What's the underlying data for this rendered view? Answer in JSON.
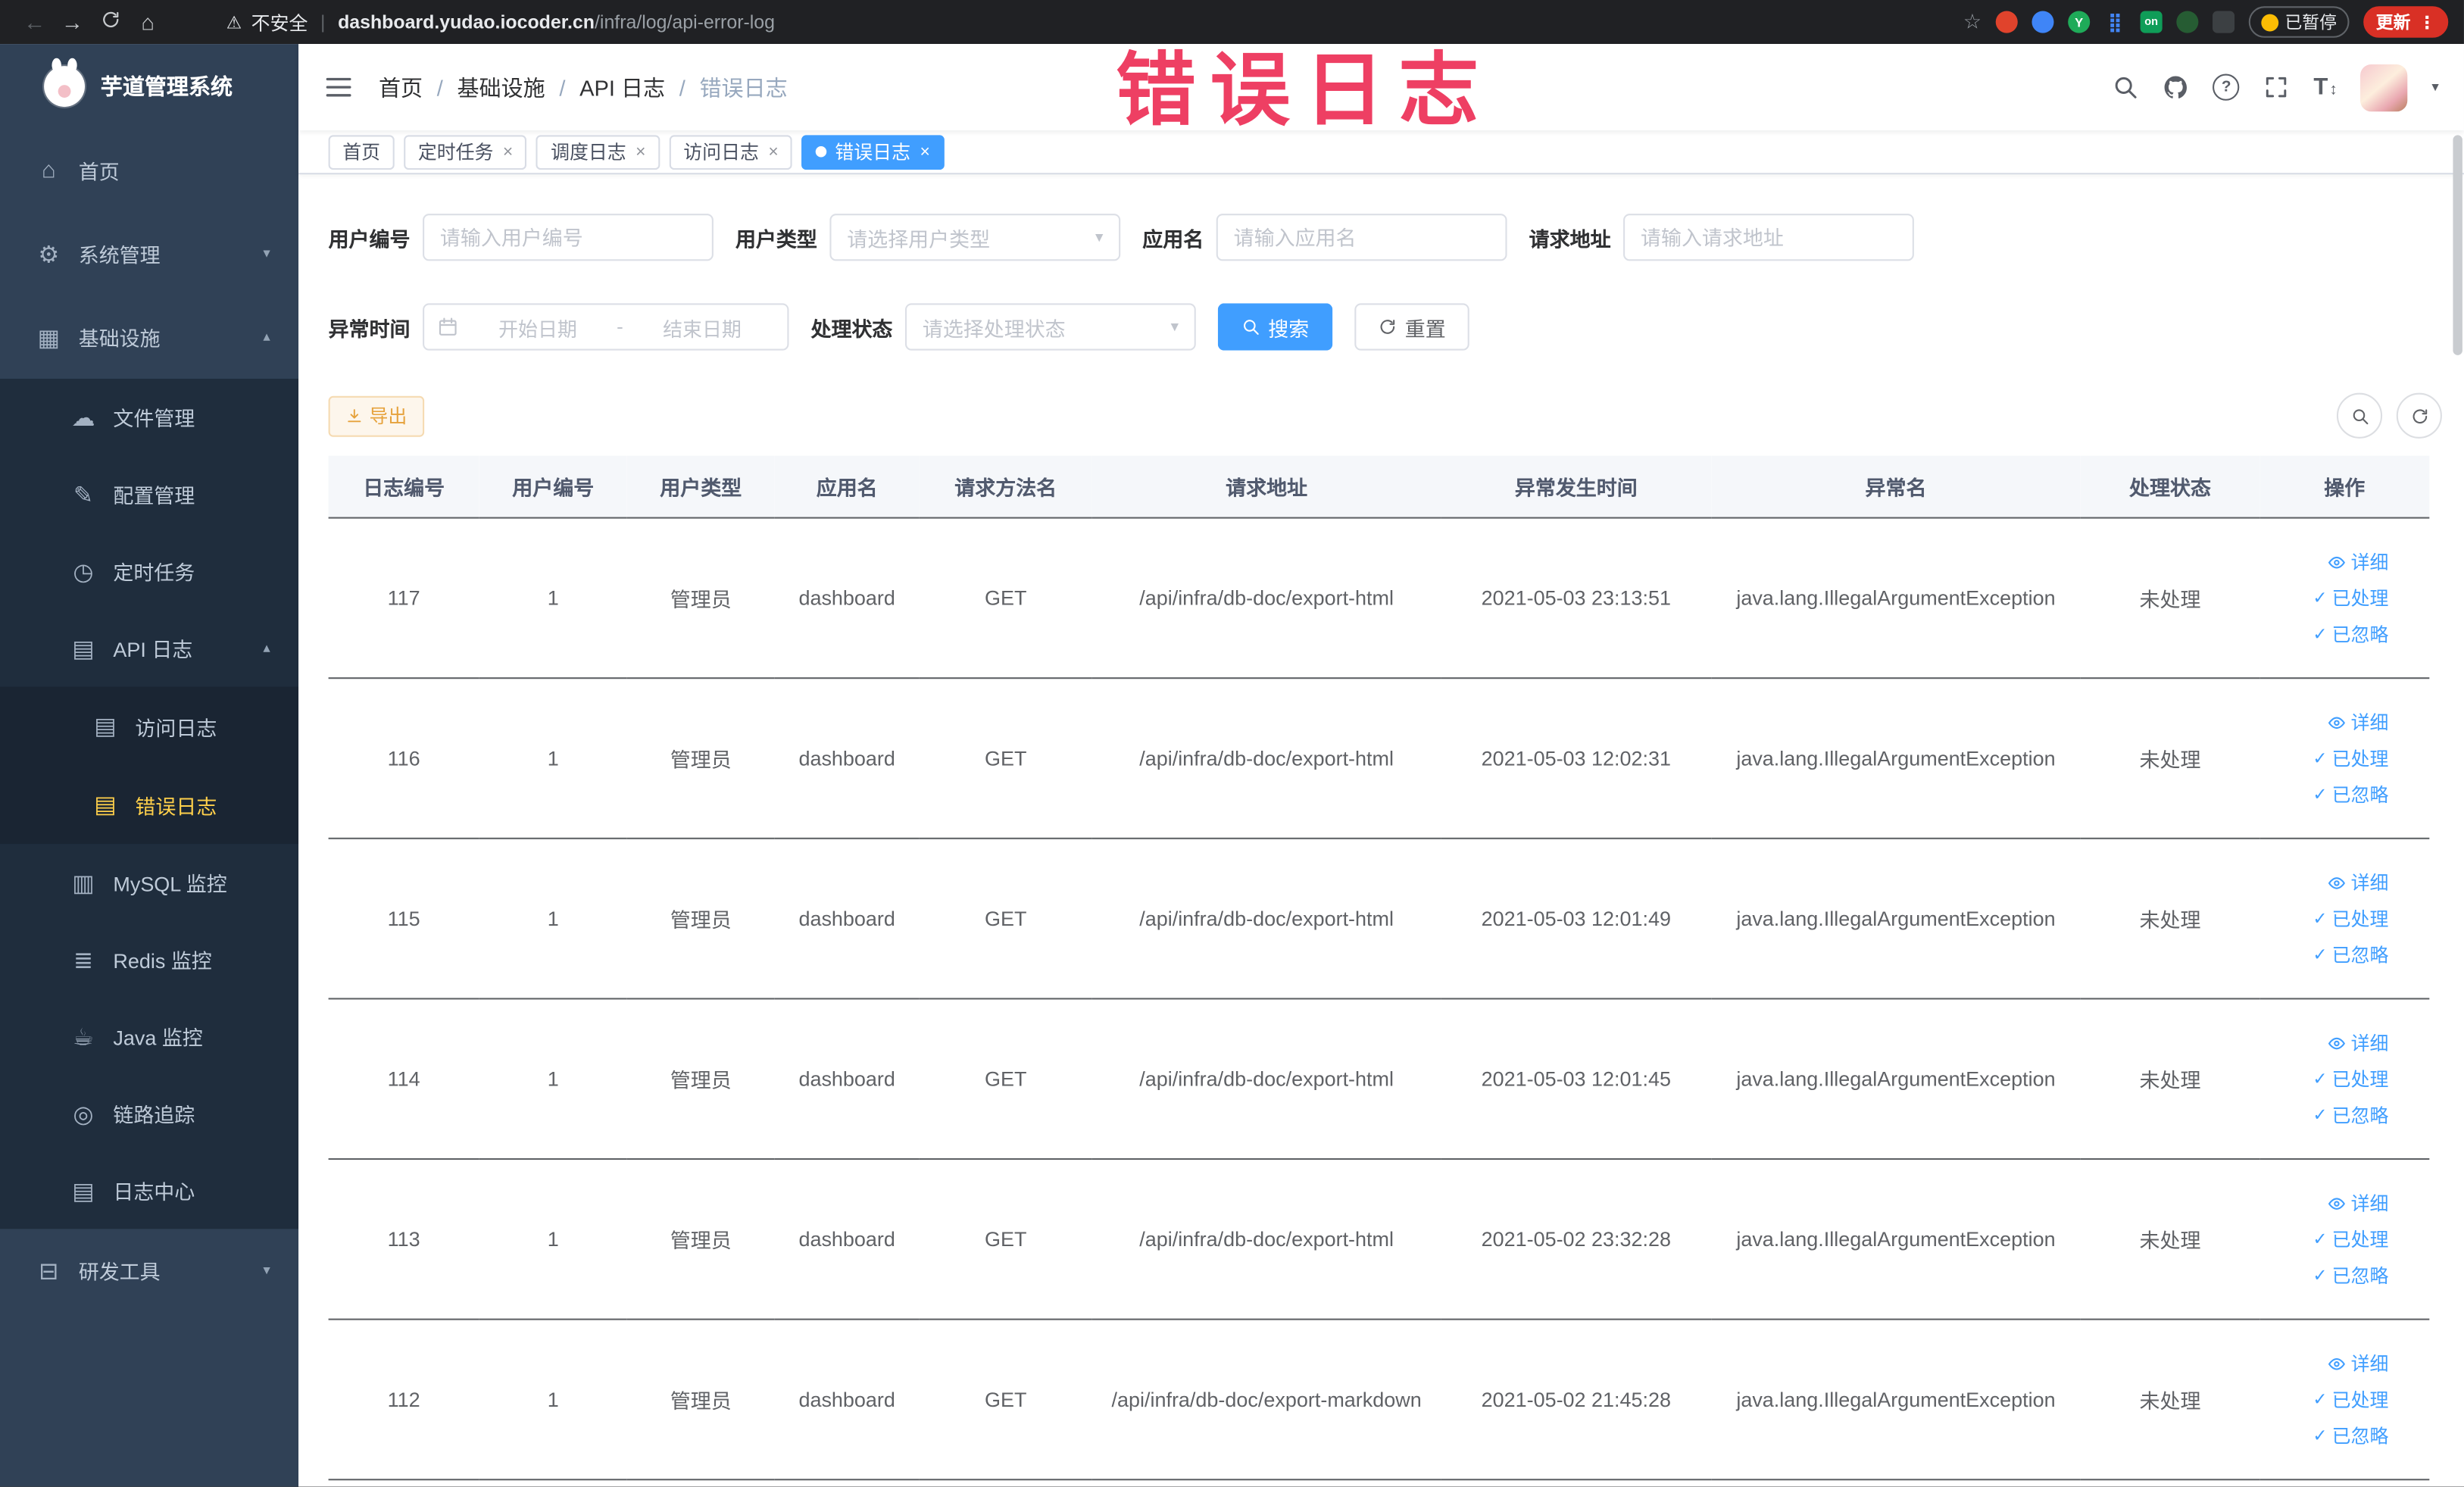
{
  "browser": {
    "security_label": "不安全",
    "divider": "|",
    "url_host": "dashboard.yudao.iocoder.cn",
    "url_path": "/infra/log/api-error-log",
    "ext_y": "Y",
    "ext_on": "on",
    "paused_label": "已暂停",
    "update_label": "更新"
  },
  "watermark_text": "错误日志",
  "icons": {
    "back": "←",
    "forward": "→",
    "home": "⌂",
    "star": "☆",
    "warning": "⚠",
    "kebab": "⋮",
    "gear": "⚙",
    "grid": "▦",
    "cloud": "☁",
    "edit": "✎",
    "clock": "◷",
    "doc": "▤",
    "log": "▤",
    "monitor": "▥",
    "db": "≣",
    "coffee": "☕",
    "trace": "◎",
    "box": "⊟",
    "chevron_down": "▾",
    "chevron_up": "▴",
    "caret": "▾",
    "close": "×",
    "check": "✓",
    "question": "?",
    "font_size": "T",
    "arrows": "↕",
    "dots": "⣿"
  },
  "sidebar": {
    "logo_title": "芋道管理系统",
    "items": [
      {
        "label": "首页",
        "icon": "home-icon"
      },
      {
        "label": "系统管理",
        "icon": "gear-icon",
        "chevron": "down"
      },
      {
        "label": "基础设施",
        "icon": "grid-icon",
        "chevron": "up"
      },
      {
        "label": "文件管理",
        "icon": "cloud-icon"
      },
      {
        "label": "配置管理",
        "icon": "edit-icon"
      },
      {
        "label": "定时任务",
        "icon": "clock-icon"
      },
      {
        "label": "API 日志",
        "icon": "doc-icon",
        "chevron": "up"
      },
      {
        "label": "访问日志",
        "icon": "log-icon"
      },
      {
        "label": "错误日志",
        "icon": "log-icon",
        "active": true
      },
      {
        "label": "MySQL 监控",
        "icon": "monitor-icon"
      },
      {
        "label": "Redis 监控",
        "icon": "database-icon"
      },
      {
        "label": "Java 监控",
        "icon": "coffee-icon"
      },
      {
        "label": "链路追踪",
        "icon": "trace-icon"
      },
      {
        "label": "日志中心",
        "icon": "log-icon"
      },
      {
        "label": "研发工具",
        "icon": "toolbox-icon",
        "chevron": "down"
      }
    ]
  },
  "breadcrumb": {
    "separator": "/",
    "items": [
      "首页",
      "基础设施",
      "API 日志",
      "错误日志"
    ]
  },
  "tabs": [
    {
      "label": "首页",
      "closable": false,
      "active": false
    },
    {
      "label": "定时任务",
      "closable": true,
      "active": false
    },
    {
      "label": "调度日志",
      "closable": true,
      "active": false
    },
    {
      "label": "访问日志",
      "closable": true,
      "active": false
    },
    {
      "label": "错误日志",
      "closable": true,
      "active": true
    }
  ],
  "filters": {
    "user_id_label": "用户编号",
    "user_id_placeholder": "请输入用户编号",
    "user_type_label": "用户类型",
    "user_type_placeholder": "请选择用户类型",
    "app_name_label": "应用名",
    "app_name_placeholder": "请输入应用名",
    "request_url_label": "请求地址",
    "request_url_placeholder": "请输入请求地址",
    "exception_time_label": "异常时间",
    "date_start_placeholder": "开始日期",
    "date_separator": "-",
    "date_end_placeholder": "结束日期",
    "process_status_label": "处理状态",
    "process_status_placeholder": "请选择处理状态",
    "search_label": "搜索",
    "reset_label": "重置"
  },
  "toolbar": {
    "export_label": "导出"
  },
  "table": {
    "columns": [
      "日志编号",
      "用户编号",
      "用户类型",
      "应用名",
      "请求方法名",
      "请求地址",
      "异常发生时间",
      "异常名",
      "处理状态",
      "操作"
    ],
    "row_actions": [
      "详细",
      "已处理",
      "已忽略"
    ],
    "rows": [
      {
        "id": "117",
        "user_id": "1",
        "user_type": "管理员",
        "app": "dashboard",
        "method": "GET",
        "url": "/api/infra/db-doc/export-html",
        "time": "2021-05-03 23:13:51",
        "exception": "java.lang.IllegalArgumentException",
        "status": "未处理"
      },
      {
        "id": "116",
        "user_id": "1",
        "user_type": "管理员",
        "app": "dashboard",
        "method": "GET",
        "url": "/api/infra/db-doc/export-html",
        "time": "2021-05-03 12:02:31",
        "exception": "java.lang.IllegalArgumentException",
        "status": "未处理"
      },
      {
        "id": "115",
        "user_id": "1",
        "user_type": "管理员",
        "app": "dashboard",
        "method": "GET",
        "url": "/api/infra/db-doc/export-html",
        "time": "2021-05-03 12:01:49",
        "exception": "java.lang.IllegalArgumentException",
        "status": "未处理"
      },
      {
        "id": "114",
        "user_id": "1",
        "user_type": "管理员",
        "app": "dashboard",
        "method": "GET",
        "url": "/api/infra/db-doc/export-html",
        "time": "2021-05-03 12:01:45",
        "exception": "java.lang.IllegalArgumentException",
        "status": "未处理"
      },
      {
        "id": "113",
        "user_id": "1",
        "user_type": "管理员",
        "app": "dashboard",
        "method": "GET",
        "url": "/api/infra/db-doc/export-html",
        "time": "2021-05-02 23:32:28",
        "exception": "java.lang.IllegalArgumentException",
        "status": "未处理"
      },
      {
        "id": "112",
        "user_id": "1",
        "user_type": "管理员",
        "app": "dashboard",
        "method": "GET",
        "url": "/api/infra/db-doc/export-markdown",
        "time": "2021-05-02 21:45:28",
        "exception": "java.lang.IllegalArgumentException",
        "status": "未处理"
      }
    ]
  },
  "colors": {
    "accent": "#409eff",
    "active_menu": "#ffd04b",
    "warning": "#e6a23c",
    "watermark": "#ee3f63"
  }
}
